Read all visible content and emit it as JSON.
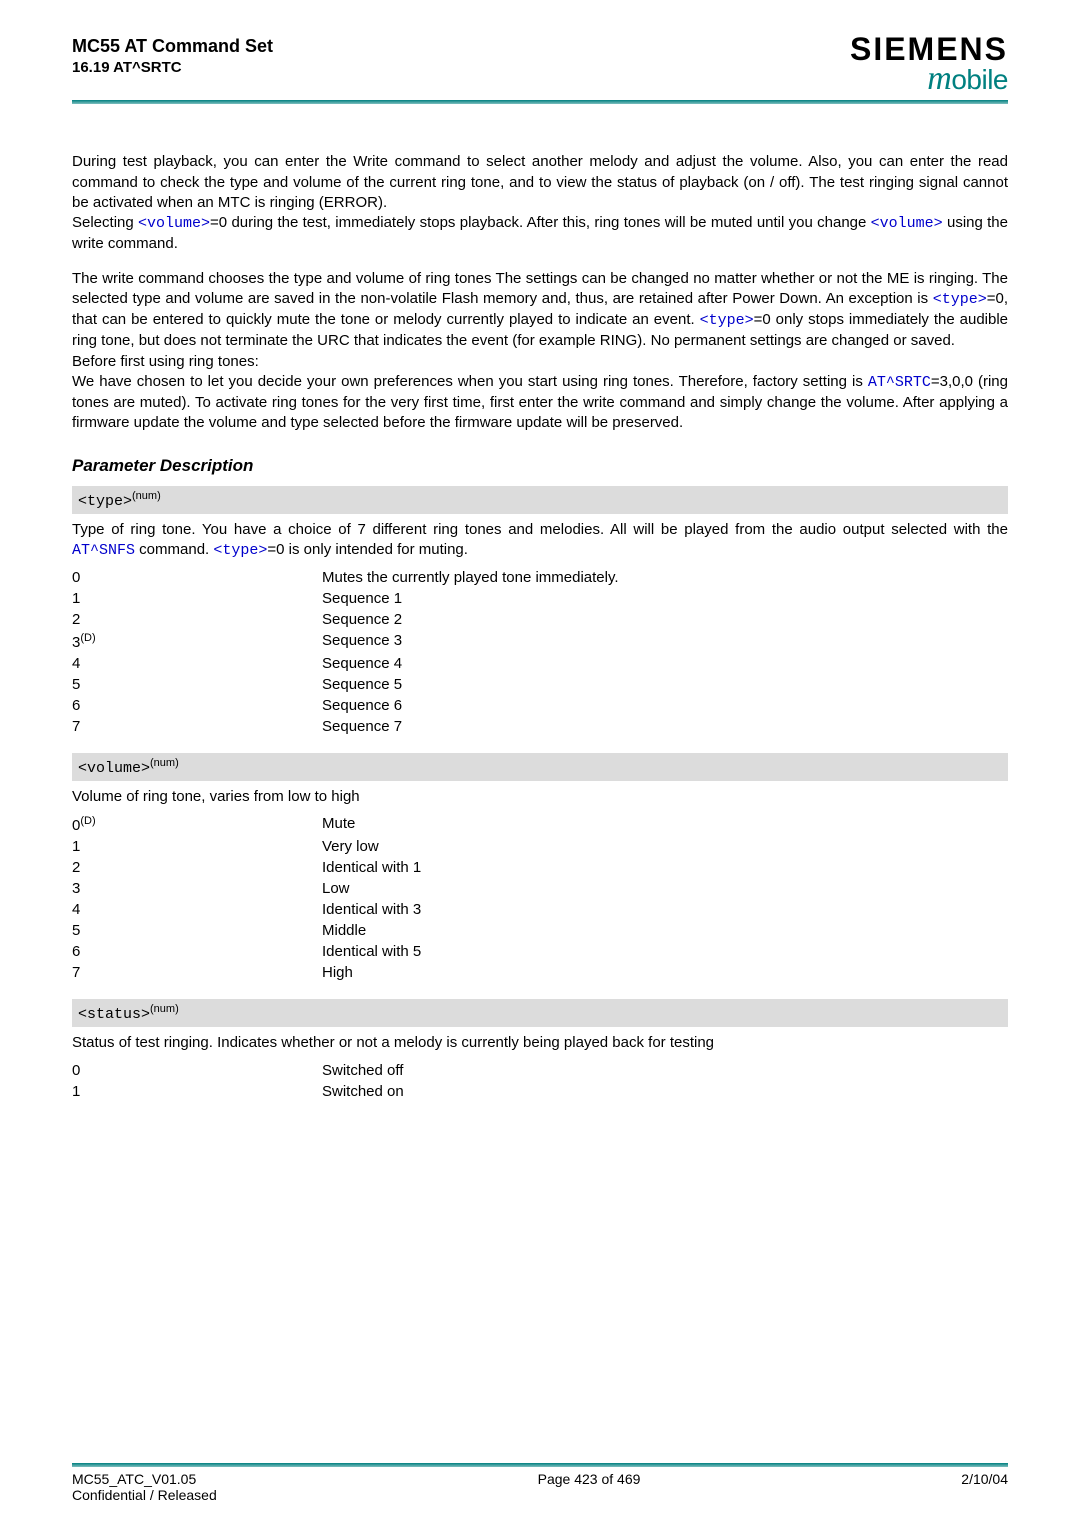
{
  "header": {
    "title": "MC55 AT Command Set",
    "sub": "16.19 AT^SRTC",
    "brand_top": "SIEMENS",
    "brand_bottom_m_prefix": "m",
    "brand_bottom_rest": "obile"
  },
  "p1_a": "During test playback, you can enter the Write command to select another melody and adjust the volume. Also, you can enter the read command to check the type and volume of the current ring tone, and to view the status of playback (on / off). The test ringing signal cannot be activated when an MTC is ringing (ERROR).",
  "p1_b1": "Selecting ",
  "p1_vol": "<volume>",
  "p1_b2": "=0 during the test, immediately stops playback. After this, ring tones will be muted until you change ",
  "p1_b3": " using the write command.",
  "p2_a": "The write command chooses the type and volume of ring tones The settings can be changed no matter whether or not the ME is ringing. The selected type and volume are saved in the non-volatile Flash memory and, thus, are retained after Power Down. An exception is ",
  "p2_type": "<type>",
  "p2_b": "=0, that can be entered to quickly mute the tone or melody currently played to indicate an event. ",
  "p2_c": "=0 only stops immediately the audible ring tone, but does not terminate the URC that indicates the event (for example RING). No permanent settings are changed or saved.",
  "p2_d": "Before first using ring tones:",
  "p2_e1": "We have chosen to let you decide your own preferences when you start using ring tones. Therefore, factory setting is ",
  "p2_cmd": "AT^SRTC",
  "p2_e2": "=3,0,0 (ring tones are muted). To activate ring tones for the very first time, first enter the write command and simply change the volume. After applying a firmware update the volume and type selected before the firmware update will be preserved.",
  "section_param_title": "Parameter Description",
  "bar_type_label": "<type>",
  "bar_sup": "(num)",
  "type_desc_a": "Type of ring tone. You have a choice of 7 different ring tones and melodies. All will be played from the audio output selected with the ",
  "type_desc_cmd": "AT^SNFS",
  "type_desc_b": " command. ",
  "type_desc_c": "=0 is only intended for muting.",
  "type_rows": [
    {
      "k": "0",
      "v": "Mutes the currently played tone immediately."
    },
    {
      "k": "1",
      "v": "Sequence 1"
    },
    {
      "k": "2",
      "v": "Sequence 2"
    },
    {
      "k": "3",
      "d": "(D)",
      "v": "Sequence 3"
    },
    {
      "k": "4",
      "v": "Sequence 4"
    },
    {
      "k": "5",
      "v": "Sequence 5"
    },
    {
      "k": "6",
      "v": "Sequence 6"
    },
    {
      "k": "7",
      "v": "Sequence 7"
    }
  ],
  "bar_volume_label": "<volume>",
  "volume_desc": "Volume of ring tone, varies from low to high",
  "volume_rows": [
    {
      "k": "0",
      "d": "(D)",
      "v": "Mute"
    },
    {
      "k": "1",
      "v": "Very low"
    },
    {
      "k": "2",
      "v": "Identical with 1"
    },
    {
      "k": "3",
      "v": "Low"
    },
    {
      "k": "4",
      "v": "Identical with 3"
    },
    {
      "k": "5",
      "v": "Middle"
    },
    {
      "k": "6",
      "v": "Identical with 5"
    },
    {
      "k": "7",
      "v": "High"
    }
  ],
  "bar_status_label": "<status>",
  "status_desc": "Status of test ringing. Indicates whether or not a melody is currently being played back for testing",
  "status_rows": [
    {
      "k": "0",
      "v": "Switched off"
    },
    {
      "k": "1",
      "v": "Switched on"
    }
  ],
  "footer": {
    "left1": "MC55_ATC_V01.05",
    "left2": "Confidential / Released",
    "center": "Page 423 of 469",
    "right": "2/10/04"
  }
}
